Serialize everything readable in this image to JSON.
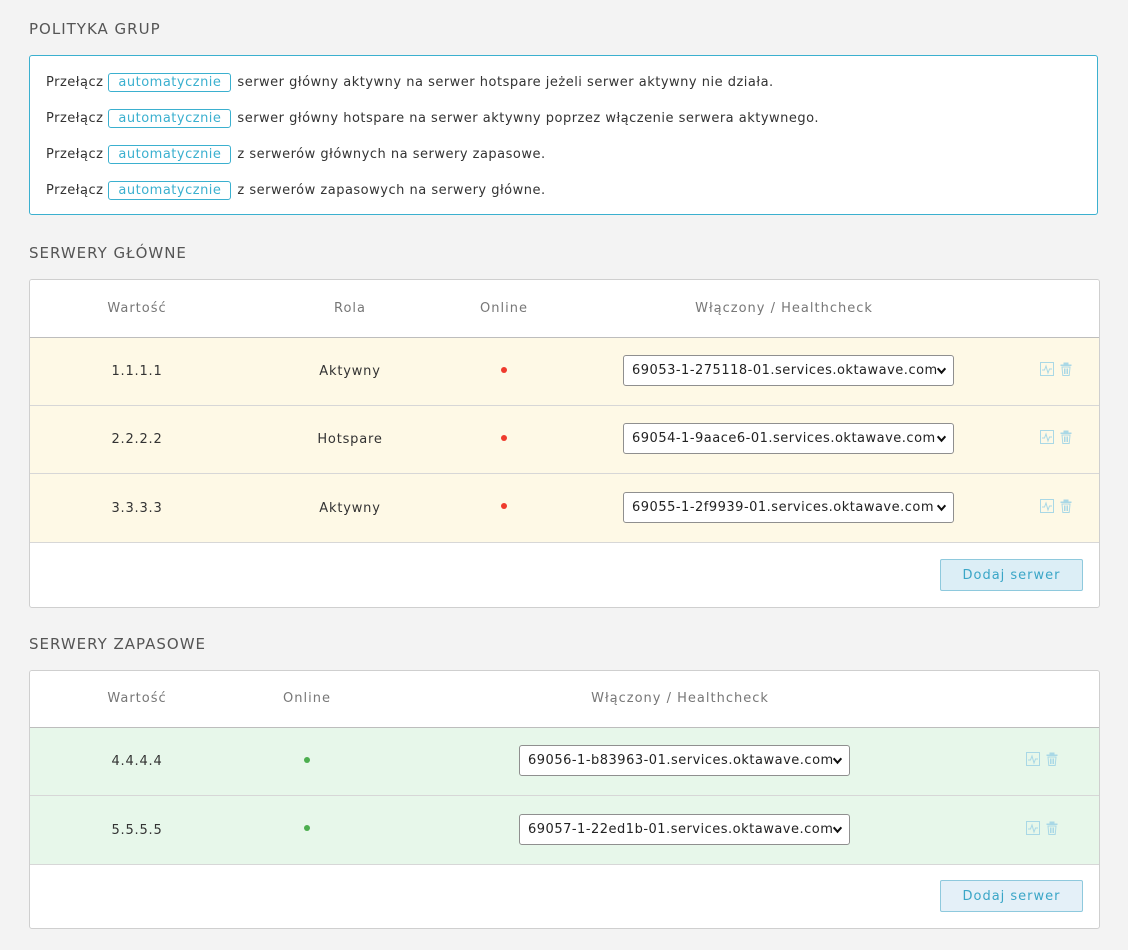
{
  "policy": {
    "title": "POLITYKA GRUP",
    "lines": [
      {
        "prefix": "Przełącz",
        "toggle": "automatycznie",
        "text": "serwer główny aktywny na serwer hotspare jeżeli serwer aktywny nie działa."
      },
      {
        "prefix": "Przełącz",
        "toggle": "automatycznie",
        "text": "serwer główny hotspare na serwer aktywny poprzez włączenie serwera aktywnego."
      },
      {
        "prefix": "Przełącz",
        "toggle": "automatycznie",
        "text": "z serwerów głównych na serwery zapasowe."
      },
      {
        "prefix": "Przełącz",
        "toggle": "automatycznie",
        "text": "z serwerów zapasowych na serwery główne."
      }
    ]
  },
  "main_servers": {
    "title": "SERWERY GŁÓWNE",
    "columns": [
      "Wartość",
      "Rola",
      "Online",
      "Włączony / Healthcheck"
    ],
    "rows": [
      {
        "value": "1.1.1.1",
        "role": "Aktywny",
        "online": false,
        "healthcheck": "69053-1-275118-01.services.oktawave.com"
      },
      {
        "value": "2.2.2.2",
        "role": "Hotspare",
        "online": false,
        "healthcheck": "69054-1-9aace6-01.services.oktawave.com"
      },
      {
        "value": "3.3.3.3",
        "role": "Aktywny",
        "online": false,
        "healthcheck": "69055-1-2f9939-01.services.oktawave.com"
      }
    ],
    "add_label": "Dodaj serwer"
  },
  "backup_servers": {
    "title": "SERWERY ZAPASOWE",
    "columns": [
      "Wartość",
      "Online",
      "Włączony / Healthcheck"
    ],
    "rows": [
      {
        "value": "4.4.4.4",
        "online": true,
        "healthcheck": "69056-1-b83963-01.services.oktawave.com"
      },
      {
        "value": "5.5.5.5",
        "online": true,
        "healthcheck": "69057-1-22ed1b-01.services.oktawave.com"
      }
    ],
    "add_label": "Dodaj serwer"
  },
  "colors": {
    "accent": "#3bb0cf",
    "offline": "#ef3b2d",
    "online": "#4cae4f",
    "main_row_bg": "#fef9e6",
    "backup_row_bg": "#e7f7ea"
  },
  "icons": {
    "row_actions": [
      "healthcheck-icon",
      "trash-icon"
    ],
    "select": "chevron-down-icon"
  }
}
